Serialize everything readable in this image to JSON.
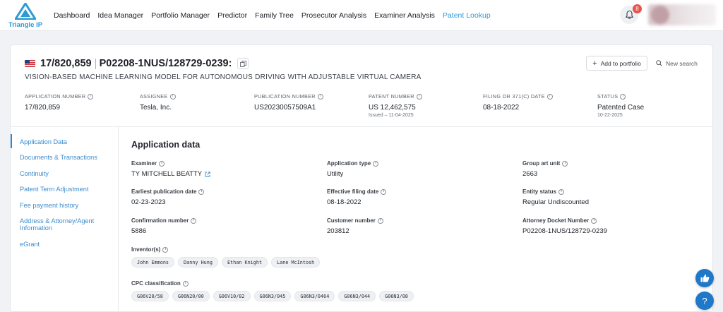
{
  "brand": {
    "name": "Triangle IP",
    "color": "#2d9bd6"
  },
  "nav": {
    "items": [
      {
        "label": "Dashboard",
        "active": false
      },
      {
        "label": "Idea Manager",
        "active": false
      },
      {
        "label": "Portfolio Manager",
        "active": false
      },
      {
        "label": "Predictor",
        "active": false
      },
      {
        "label": "Family Tree",
        "active": false
      },
      {
        "label": "Prosecutor Analysis",
        "active": false
      },
      {
        "label": "Examiner Analysis",
        "active": false
      },
      {
        "label": "Patent Lookup",
        "active": true
      }
    ],
    "notifications_count": "8",
    "bell_icon": "bell-icon"
  },
  "header": {
    "country_flag": "us-flag-icon",
    "application_number": "17/820,859",
    "docket_number": "P02208-1NUS/128729-0239:",
    "title": "VISION-BASED MACHINE LEARNING MODEL FOR AUTONOMOUS DRIVING WITH ADJUSTABLE VIRTUAL CAMERA",
    "add_to_portfolio_label": "Add to portfolio",
    "new_search_label": "New search"
  },
  "summary": [
    {
      "label": "APPLICATION NUMBER",
      "value": "17/820,859",
      "sub": ""
    },
    {
      "label": "ASSIGNEE",
      "value": "Tesla, Inc.",
      "sub": ""
    },
    {
      "label": "PUBLICATION NUMBER",
      "value": "US20230057509A1",
      "sub": ""
    },
    {
      "label": "PATENT NUMBER",
      "value": "US 12,462,575",
      "sub": "Issued – 11-04-2025"
    },
    {
      "label": "FILING OR 371(C) DATE",
      "value": "08-18-2022",
      "sub": ""
    },
    {
      "label": "STATUS",
      "value": "Patented Case",
      "sub": "10-22-2025"
    }
  ],
  "sidebar": {
    "items": [
      {
        "label": "Application Data",
        "active": true
      },
      {
        "label": "Documents & Transactions",
        "active": false
      },
      {
        "label": "Continuity",
        "active": false
      },
      {
        "label": "Patent Term Adjustment",
        "active": false
      },
      {
        "label": "Fee payment history",
        "active": false
      },
      {
        "label": "Address & Attorney/Agent Information",
        "active": false
      },
      {
        "label": "eGrant",
        "active": false
      }
    ]
  },
  "application_data": {
    "section_title": "Application data",
    "fields": [
      {
        "label": "Examiner",
        "value": "TY MITCHELL BEATTY"
      },
      {
        "label": "Application type",
        "value": "Utility"
      },
      {
        "label": "Group art unit",
        "value": "2663"
      },
      {
        "label": "Earliest publication date",
        "value": "02-23-2023"
      },
      {
        "label": "Effective filing date",
        "value": "08-18-2022"
      },
      {
        "label": "Entity status",
        "value": "Regular Undiscounted"
      },
      {
        "label": "Confirmation number",
        "value": "5886"
      },
      {
        "label": "Customer number",
        "value": "203812"
      },
      {
        "label": "Attorney Docket Number",
        "value": "P02208-1NUS/128729-0239"
      }
    ],
    "inventors_label": "Inventor(s)",
    "inventors": [
      "John Emmons",
      "Danny Hung",
      "Ethan Knight",
      "Lane McIntosh"
    ],
    "cpc_label": "CPC classification",
    "cpc": [
      "G06V20/58",
      "G06N20/00",
      "G06V10/82",
      "G06N3/045",
      "G06N3/0464",
      "G06N3/044",
      "G06N3/08"
    ]
  },
  "floating": {
    "like_icon": "thumbs-up-icon",
    "help_label": "?"
  }
}
